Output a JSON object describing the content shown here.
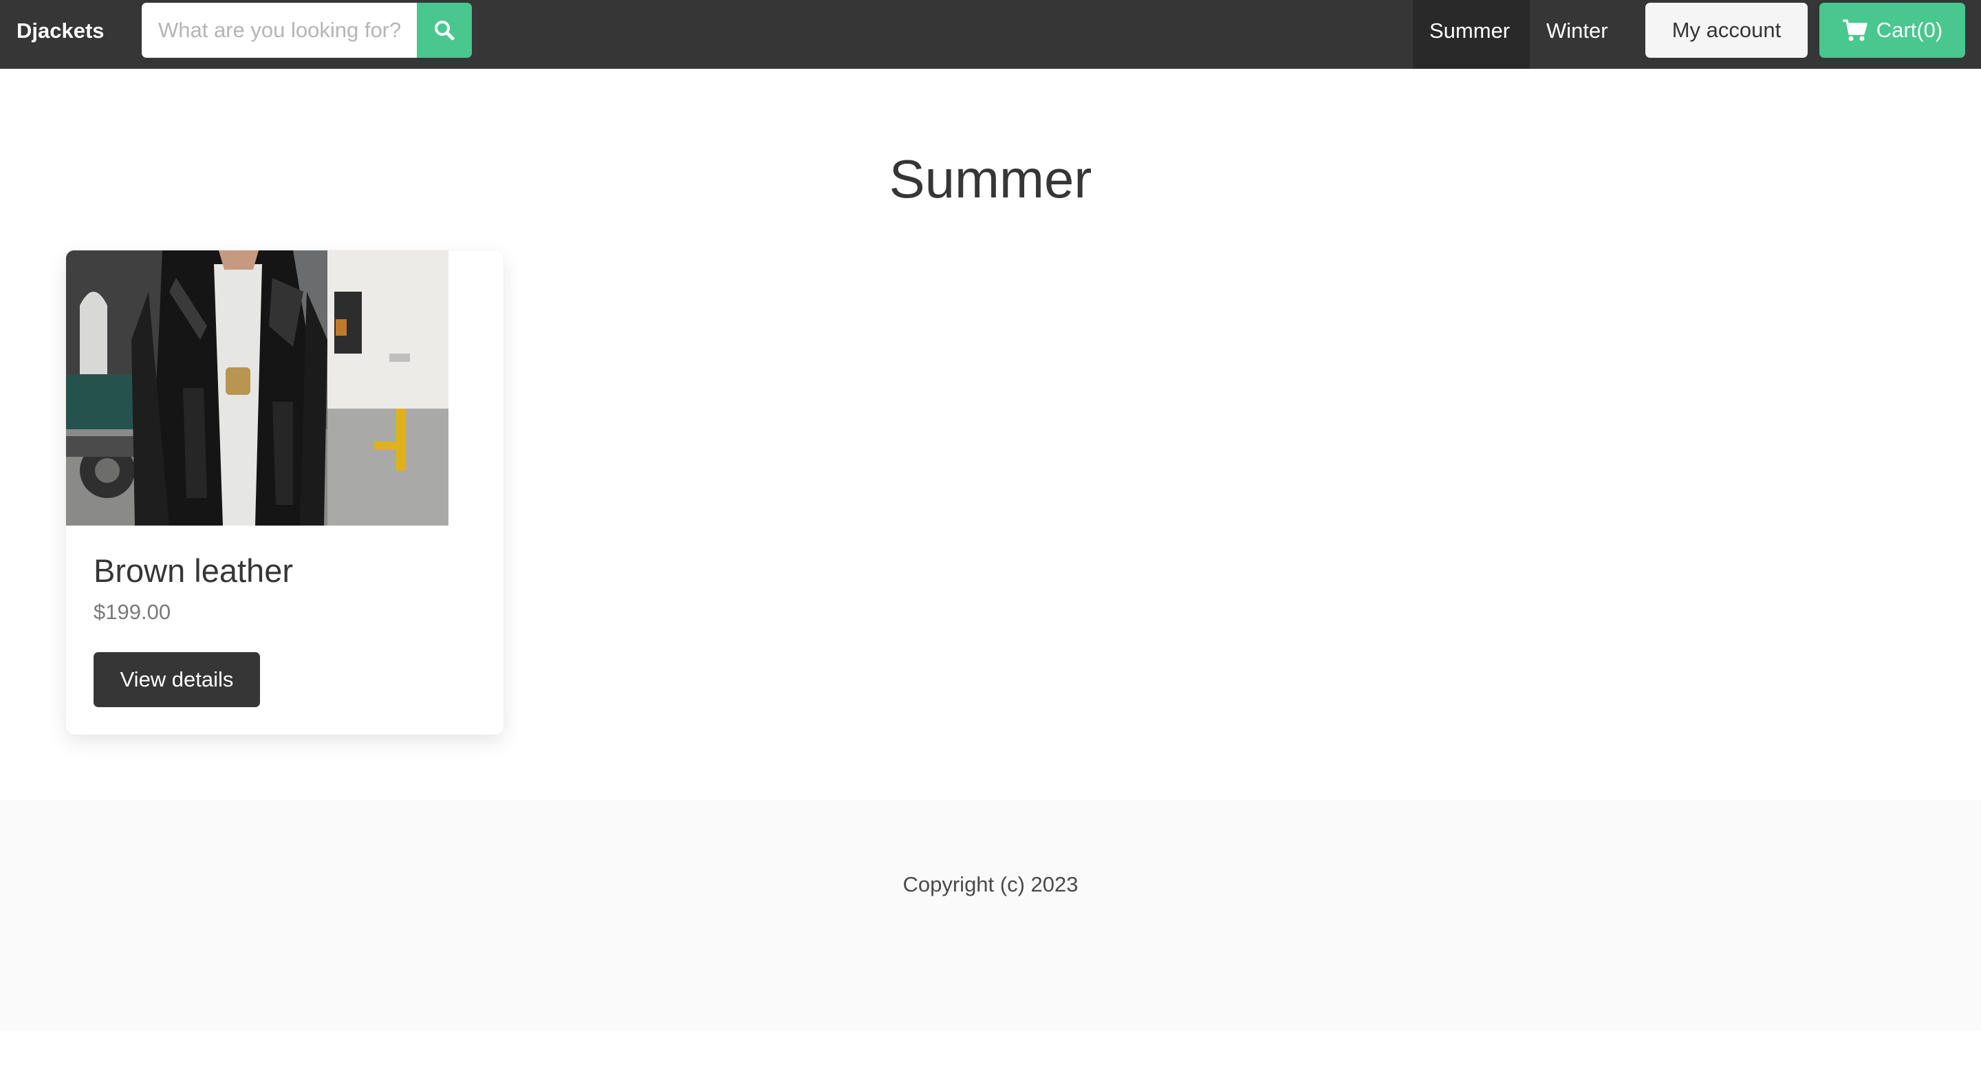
{
  "navbar": {
    "brand": "Djackets",
    "search": {
      "placeholder": "What are you looking for?",
      "value": "",
      "button_icon": "search-icon"
    },
    "items": [
      {
        "label": "Summer",
        "active": true
      },
      {
        "label": "Winter",
        "active": false
      }
    ],
    "account_label": "My account",
    "cart_label": "Cart(0)",
    "cart_icon": "shopping-cart-icon"
  },
  "main": {
    "title": "Summer",
    "products": [
      {
        "name": "Brown leather",
        "price": "$199.00",
        "button_label": "View details"
      }
    ]
  },
  "footer": {
    "copyright": "Copyright (c) 2023"
  },
  "colors": {
    "navbar_bg": "#363636",
    "accent": "#48c78e",
    "dark_button": "#363636",
    "footer_bg": "#fafafa"
  }
}
